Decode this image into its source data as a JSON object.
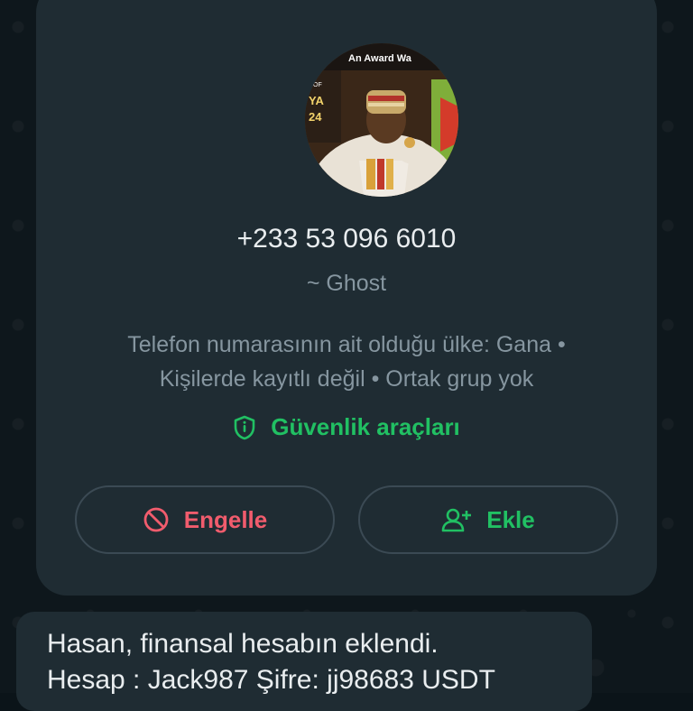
{
  "contact": {
    "phone": "+233 53 096 6010",
    "alias": "~ Ghost",
    "country_line": "Telefon numarasının ait olduğu ülke: Gana •",
    "status_line": "Kişilerde kayıtlı değil • Ortak grup yok",
    "avatar_banner": "An Award Wa",
    "avatar_side_text_1": "N OF",
    "avatar_side_text_2": "YA",
    "avatar_side_text_3": "24"
  },
  "security": {
    "label": "Güvenlik araçları",
    "icon": "shield-icon"
  },
  "actions": {
    "block_label": "Engelle",
    "block_icon": "block-icon",
    "add_label": "Ekle",
    "add_icon": "add-person-icon"
  },
  "message": {
    "line1": "Hasan, finansal hesabın eklendi.",
    "line2": "Hesap : Jack987 Şifre: jj98683 USDT"
  },
  "colors": {
    "background": "#0b1419",
    "card": "#1f2c33",
    "text_primary": "#e9edef",
    "text_secondary": "#8696a0",
    "accent_green": "#21c063",
    "danger_red": "#f15c6d",
    "button_border": "#3b4a54"
  }
}
